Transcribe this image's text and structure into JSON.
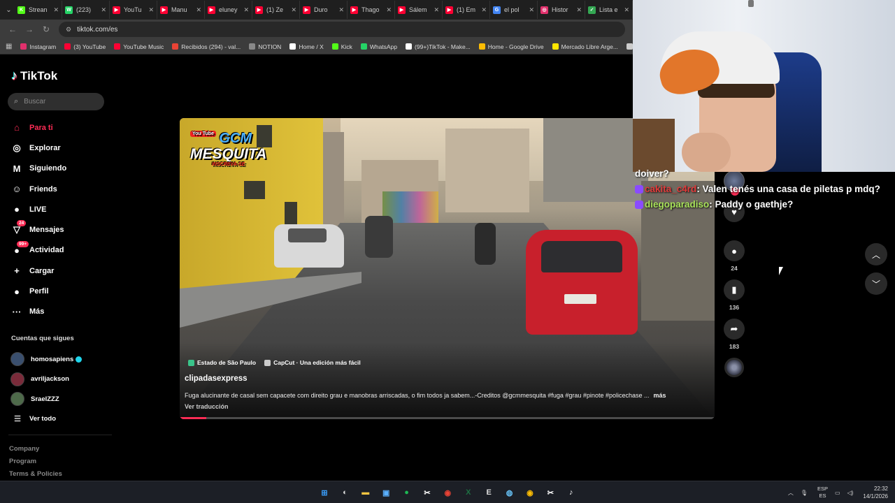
{
  "browser": {
    "tabs": [
      {
        "label": "Strean",
        "color": "#53fc18",
        "glyph": "K"
      },
      {
        "label": "(223)",
        "color": "#25d366",
        "glyph": "W"
      },
      {
        "label": "YouTu",
        "color": "#ff0033",
        "glyph": "▶"
      },
      {
        "label": "Manu",
        "color": "#ff0033",
        "glyph": "▶"
      },
      {
        "label": "eluney",
        "color": "#ff0033",
        "glyph": "▶"
      },
      {
        "label": "(1) Ze",
        "color": "#ff0033",
        "glyph": "▶"
      },
      {
        "label": "Duro",
        "color": "#ff0033",
        "glyph": "▶"
      },
      {
        "label": "Thago",
        "color": "#ff0033",
        "glyph": "▶"
      },
      {
        "label": "Sálem",
        "color": "#ff0033",
        "glyph": "▶"
      },
      {
        "label": "(1) Em",
        "color": "#ff0033",
        "glyph": "▶"
      },
      {
        "label": "el pol",
        "color": "#4285f4",
        "glyph": "G"
      },
      {
        "label": "Histor",
        "color": "#e1306c",
        "glyph": "◎"
      },
      {
        "label": "Lista e",
        "color": "#34a853",
        "glyph": "✓"
      }
    ],
    "url": "tiktok.com/es",
    "bookmarks": [
      {
        "label": "Instagram",
        "color": "#e1306c"
      },
      {
        "label": "(3) YouTube",
        "color": "#ff0033"
      },
      {
        "label": "YouTube Music",
        "color": "#ff0033"
      },
      {
        "label": "Recibidos (294) - val...",
        "color": "#ea4335"
      },
      {
        "label": "NOTION",
        "color": "#888888"
      },
      {
        "label": "Home / X",
        "color": "#ffffff"
      },
      {
        "label": "Kick",
        "color": "#53fc18"
      },
      {
        "label": "WhatsApp",
        "color": "#25d366"
      },
      {
        "label": "(99+)TikTok - Make...",
        "color": "#ffffff"
      },
      {
        "label": "Home - Google Drive",
        "color": "#fbbc04"
      },
      {
        "label": "Mercado Libre Arge...",
        "color": "#ffe600"
      },
      {
        "label": "PRO",
        "color": "#cccccc"
      }
    ]
  },
  "tiktok": {
    "brand": "TikTok",
    "search_placeholder": "Buscar",
    "nav": [
      {
        "label": "Para ti",
        "icon": "home-icon",
        "glyph": "⌂",
        "active": true
      },
      {
        "label": "Explorar",
        "icon": "compass-icon",
        "glyph": "◎"
      },
      {
        "label": "Siguiendo",
        "icon": "following-icon",
        "glyph": "M"
      },
      {
        "label": "Friends",
        "icon": "friends-icon",
        "glyph": "☺"
      },
      {
        "label": "LIVE",
        "icon": "live-icon",
        "glyph": "●"
      },
      {
        "label": "Mensajes",
        "icon": "messages-icon",
        "glyph": "▽",
        "badge": "24"
      },
      {
        "label": "Actividad",
        "icon": "activity-icon",
        "glyph": "●",
        "badge": "99+"
      },
      {
        "label": "Cargar",
        "icon": "upload-icon",
        "glyph": "+"
      },
      {
        "label": "Perfil",
        "icon": "profile-icon",
        "glyph": "●"
      },
      {
        "label": "Más",
        "icon": "more-icon",
        "glyph": "···"
      }
    ],
    "following_title": "Cuentas que sigues",
    "following": [
      {
        "name": "homosapiens",
        "verified": true,
        "color": "#3a4f6e"
      },
      {
        "name": "avriljackson",
        "verified": false,
        "color": "#7a2b3a"
      },
      {
        "name": "SraelZZZ",
        "verified": false,
        "color": "#4e6a4a"
      }
    ],
    "see_all": "Ver todo",
    "footer": [
      "Company",
      "Program",
      "Terms & Policies"
    ]
  },
  "video": {
    "watermark_yt": "You Tube",
    "watermark_gcm": "GCM",
    "watermark_city": "MESQUITA",
    "watermark_sub": "INSCREVA-SE",
    "location_tag": "Estado de São Paulo",
    "capcut_tag": "CapCut · Una edición más fácil",
    "author": "clipadasexpress",
    "description": "Fuga alucinante de casal sem capacete com direito grau e manobras arriscadas, o fim todos ja sabem...-Creditos @gcmmesquita #fuga #grau #pinote #policechase ...",
    "more": "más",
    "translate": "Ver traducción",
    "progress": 0.05
  },
  "actions": [
    {
      "icon": "heart-icon",
      "glyph": "♥",
      "count": ""
    },
    {
      "icon": "comment-icon",
      "glyph": "●",
      "count": "24"
    },
    {
      "icon": "bookmark-icon",
      "glyph": "▮",
      "count": "136"
    },
    {
      "icon": "share-icon",
      "glyph": "➦",
      "count": "183"
    }
  ],
  "chat": [
    {
      "user": "",
      "msg": "doiver?"
    },
    {
      "user": "cakita_c4rd",
      "msg": "Valen tenés una casa de piletas p mdq?",
      "color": "#e23b3b"
    },
    {
      "user": "diegoparadiso",
      "msg": "Paddy o gaethje?",
      "color": "#a8e25a"
    }
  ],
  "taskbar": {
    "apps": [
      {
        "name": "windows-start-icon",
        "glyph": "⊞",
        "color": "#3aa0ff"
      },
      {
        "name": "copilot-icon",
        "glyph": "◐",
        "color": "#dddddd"
      },
      {
        "name": "file-explorer-icon",
        "glyph": "▬",
        "color": "#f5c542"
      },
      {
        "name": "store-icon",
        "glyph": "▣",
        "color": "#5ab0ff"
      },
      {
        "name": "spotify-icon",
        "glyph": "●",
        "color": "#1db954"
      },
      {
        "name": "capcut-icon",
        "glyph": "✂",
        "color": "#ffffff"
      },
      {
        "name": "chrome-icon",
        "glyph": "◉",
        "color": "#ea4335"
      },
      {
        "name": "excel-icon",
        "glyph": "X",
        "color": "#1d6f42"
      },
      {
        "name": "epic-games-icon",
        "glyph": "E",
        "color": "#dddddd"
      },
      {
        "name": "steam-icon",
        "glyph": "◍",
        "color": "#66c0f4"
      },
      {
        "name": "chrome-active-icon",
        "glyph": "◉",
        "color": "#fbbc04"
      },
      {
        "name": "capcut-2-icon",
        "glyph": "✂",
        "color": "#ffffff"
      },
      {
        "name": "tiktok-icon",
        "glyph": "♪",
        "color": "#ffffff"
      }
    ],
    "lang_top": "ESP",
    "lang_bottom": "ES",
    "time": "22:32",
    "date": "14/1/2026"
  }
}
